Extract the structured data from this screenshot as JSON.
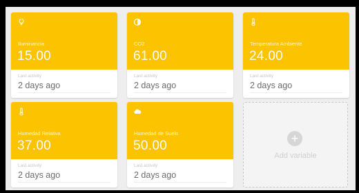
{
  "cards": [
    {
      "name": "Iluminancia",
      "value": "15.00",
      "last_label": "Last activity",
      "last_value": "2 days ago",
      "icon": "lightbulb-icon"
    },
    {
      "name": "CO2",
      "value": "61.00",
      "last_label": "Last activity",
      "last_value": "2 days ago",
      "icon": "contrast-icon"
    },
    {
      "name": "Temperatura Ambiente",
      "value": "24.00",
      "last_label": "Last activity",
      "last_value": "2 days ago",
      "icon": "thermometer-icon"
    },
    {
      "name": "Humedad Relativa",
      "value": "37.00",
      "last_label": "Last activity",
      "last_value": "2 days ago",
      "icon": "thermometer-icon"
    },
    {
      "name": "Humedad de Suelo",
      "value": "50.00",
      "last_label": "Last activity",
      "last_value": "2 days ago",
      "icon": "cloud-icon"
    }
  ],
  "add_card": {
    "label": "Add variable",
    "icon": "plus-icon"
  },
  "colors": {
    "card_header": "#fcc300",
    "board_background": "#eeeeee",
    "frame": "#000000"
  }
}
